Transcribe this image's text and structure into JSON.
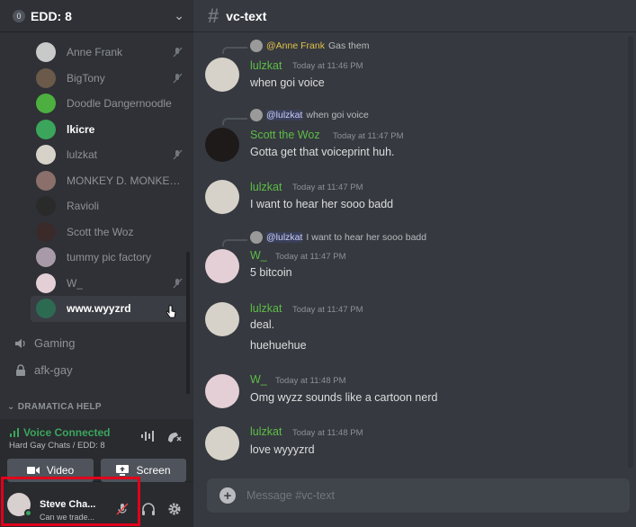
{
  "server": {
    "badge": "0",
    "name": "EDD: 8"
  },
  "members": [
    {
      "name": "Anne Frank",
      "muted": true,
      "avatar_color": "#c9c9c9"
    },
    {
      "name": "BigTony",
      "muted": true,
      "avatar_color": "#6b5a4a"
    },
    {
      "name": "Doodle Dangernoodle",
      "muted": false,
      "avatar_color": "#4caf3f"
    },
    {
      "name": "lkicre",
      "muted": false,
      "avatar_color": "#3ba55c"
    },
    {
      "name": "lulzkat",
      "muted": true,
      "avatar_color": "#d6d2c9"
    },
    {
      "name": "MONKEY D. MONKEY ...",
      "muted": false,
      "avatar_color": "#8a6f6a"
    },
    {
      "name": "Ravioli",
      "muted": false,
      "avatar_color": "#2a2a2a"
    },
    {
      "name": "Scott the Woz",
      "muted": false,
      "avatar_color": "#3a2a2a"
    },
    {
      "name": "tummy pic factory",
      "muted": false,
      "avatar_color": "#a89aa8"
    },
    {
      "name": "W_",
      "muted": true,
      "avatar_color": "#e3cfd5"
    },
    {
      "name": "www.wyyzrd",
      "muted": false,
      "avatar_color": "#2d6a52"
    }
  ],
  "channels": {
    "gaming": "Gaming",
    "afk": "afk-gay",
    "category": "DRAMATICA HELP"
  },
  "voice": {
    "status": "Voice Connected",
    "location": "Hard Gay Chats / EDD: 8",
    "video_label": "Video",
    "screen_label": "Screen"
  },
  "user": {
    "name": "Steve Cha...",
    "status": "Can we trade..."
  },
  "channel_header": {
    "name": "vc-text"
  },
  "messages": [
    {
      "author": "lulzkat",
      "time": "Today at 11:46 PM",
      "lines": [
        "when goi voice"
      ],
      "reply": {
        "mention": "@Anne Frank",
        "text": "Gas them"
      }
    },
    {
      "author": "Scott the Woz",
      "time": "Today at 11:47 PM",
      "lines": [
        "Gotta get that voiceprint huh."
      ],
      "reply": {
        "mention": "@lulzkat",
        "text": "when goi voice"
      }
    },
    {
      "author": "lulzkat",
      "time": "Today at 11:47 PM",
      "lines": [
        "I want to hear her sooo badd"
      ]
    },
    {
      "author": "W_",
      "time": "Today at 11:47 PM",
      "lines": [
        "5 bitcoin"
      ],
      "reply": {
        "mention": "@lulzkat",
        "text": "I want to hear her sooo badd"
      }
    },
    {
      "author": "lulzkat",
      "time": "Today at 11:47 PM",
      "lines": [
        "deal.",
        "huehuehue"
      ]
    },
    {
      "author": "W_",
      "time": "Today at 11:48 PM",
      "lines": [
        "Omg wyzz sounds like a cartoon nerd"
      ]
    },
    {
      "author": "lulzkat",
      "time": "Today at 11:48 PM",
      "lines": [
        "love wyyyzrd"
      ]
    }
  ],
  "composer": {
    "placeholder": "Message #vc-text"
  },
  "colors": {
    "accent_green": "#5dbd47",
    "voice_green": "#3ba55c",
    "highlight_red": "#e0001b",
    "reply_yellow": "#e1c14a"
  }
}
